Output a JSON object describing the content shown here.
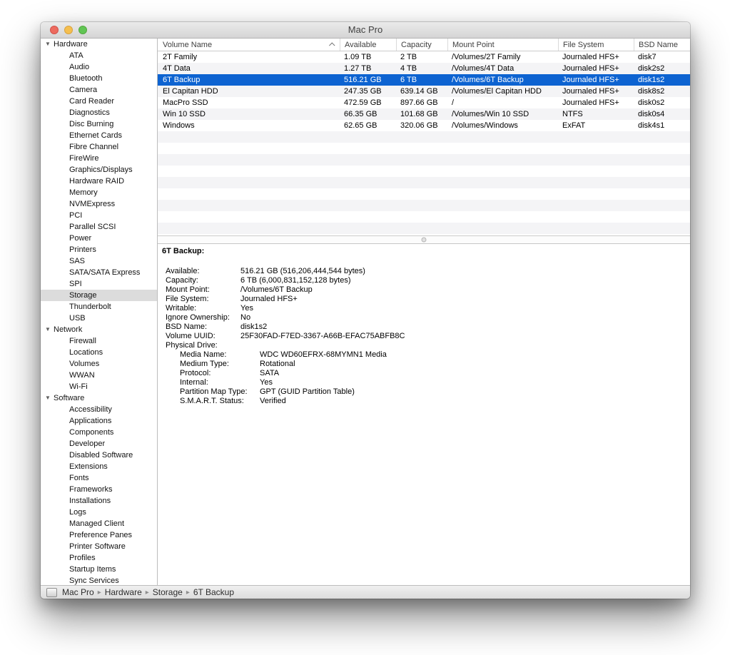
{
  "window": {
    "title": "Mac Pro"
  },
  "sidebar": {
    "selected": "Storage",
    "sections": [
      {
        "label": "Hardware",
        "expanded": true,
        "items": [
          "ATA",
          "Audio",
          "Bluetooth",
          "Camera",
          "Card Reader",
          "Diagnostics",
          "Disc Burning",
          "Ethernet Cards",
          "Fibre Channel",
          "FireWire",
          "Graphics/Displays",
          "Hardware RAID",
          "Memory",
          "NVMExpress",
          "PCI",
          "Parallel SCSI",
          "Power",
          "Printers",
          "SAS",
          "SATA/SATA Express",
          "SPI",
          "Storage",
          "Thunderbolt",
          "USB"
        ]
      },
      {
        "label": "Network",
        "expanded": true,
        "items": [
          "Firewall",
          "Locations",
          "Volumes",
          "WWAN",
          "Wi-Fi"
        ]
      },
      {
        "label": "Software",
        "expanded": true,
        "items": [
          "Accessibility",
          "Applications",
          "Components",
          "Developer",
          "Disabled Software",
          "Extensions",
          "Fonts",
          "Frameworks",
          "Installations",
          "Logs",
          "Managed Client",
          "Preference Panes",
          "Printer Software",
          "Profiles",
          "Startup Items",
          "Sync Services"
        ]
      }
    ]
  },
  "table": {
    "columns": [
      "Volume Name",
      "Available",
      "Capacity",
      "Mount Point",
      "File System",
      "BSD Name"
    ],
    "sort_column": "Volume Name",
    "sort_direction": "ascending",
    "selected_row": "6T Backup",
    "rows": [
      [
        "2T Family",
        "1.09 TB",
        "2 TB",
        "/Volumes/2T Family",
        "Journaled HFS+",
        "disk7"
      ],
      [
        "4T Data",
        "1.27 TB",
        "4 TB",
        "/Volumes/4T Data",
        "Journaled HFS+",
        "disk2s2"
      ],
      [
        "6T Backup",
        "516.21 GB",
        "6 TB",
        "/Volumes/6T Backup",
        "Journaled HFS+",
        "disk1s2"
      ],
      [
        "El Capitan HDD",
        "247.35 GB",
        "639.14 GB",
        "/Volumes/El Capitan HDD",
        "Journaled HFS+",
        "disk8s2"
      ],
      [
        "MacPro SSD",
        "472.59 GB",
        "897.66 GB",
        "/",
        "Journaled HFS+",
        "disk0s2"
      ],
      [
        "Win 10 SSD",
        "66.35 GB",
        "101.68 GB",
        "/Volumes/Win 10 SSD",
        "NTFS",
        "disk0s4"
      ],
      [
        "Windows",
        "62.65 GB",
        "320.06 GB",
        "/Volumes/Windows",
        "ExFAT",
        "disk4s1"
      ]
    ]
  },
  "detail": {
    "title": "6T Backup:",
    "fields": [
      {
        "label": "Available:",
        "value": "516.21 GB (516,206,444,544 bytes)",
        "indent": 0
      },
      {
        "label": "Capacity:",
        "value": "6 TB (6,000,831,152,128 bytes)",
        "indent": 0
      },
      {
        "label": "Mount Point:",
        "value": "/Volumes/6T Backup",
        "indent": 0
      },
      {
        "label": "File System:",
        "value": "Journaled HFS+",
        "indent": 0
      },
      {
        "label": "Writable:",
        "value": "Yes",
        "indent": 0
      },
      {
        "label": "Ignore Ownership:",
        "value": "No",
        "indent": 0
      },
      {
        "label": "BSD Name:",
        "value": "disk1s2",
        "indent": 0
      },
      {
        "label": "Volume UUID:",
        "value": "25F30FAD-F7ED-3367-A66B-EFAC75ABFB8C",
        "indent": 0
      },
      {
        "label": "Physical Drive:",
        "value": "",
        "indent": 0
      },
      {
        "label": "Media Name:",
        "value": "WDC WD60EFRX-68MYMN1 Media",
        "indent": 1
      },
      {
        "label": "Medium Type:",
        "value": "Rotational",
        "indent": 1
      },
      {
        "label": "Protocol:",
        "value": "SATA",
        "indent": 1
      },
      {
        "label": "Internal:",
        "value": "Yes",
        "indent": 1
      },
      {
        "label": "Partition Map Type:",
        "value": "GPT (GUID Partition Table)",
        "indent": 1
      },
      {
        "label": "S.M.A.R.T. Status:",
        "value": "Verified",
        "indent": 1
      }
    ]
  },
  "statusbar": {
    "breadcrumbs": [
      "Mac Pro",
      "Hardware",
      "Storage",
      "6T Backup"
    ],
    "separator": "▸"
  },
  "icons": {
    "disclosure_expanded": "▼"
  },
  "colors": {
    "selection_blue": "#0d63d1",
    "sidebar_selected_gray": "#dcdcdc",
    "row_stripe": "#f4f4f6",
    "titlebar_top": "#ebebeb",
    "titlebar_bottom": "#d5d4d5",
    "traffic_red": "#ed6b5f",
    "traffic_yellow": "#f5bf4f",
    "traffic_green": "#61c554"
  }
}
